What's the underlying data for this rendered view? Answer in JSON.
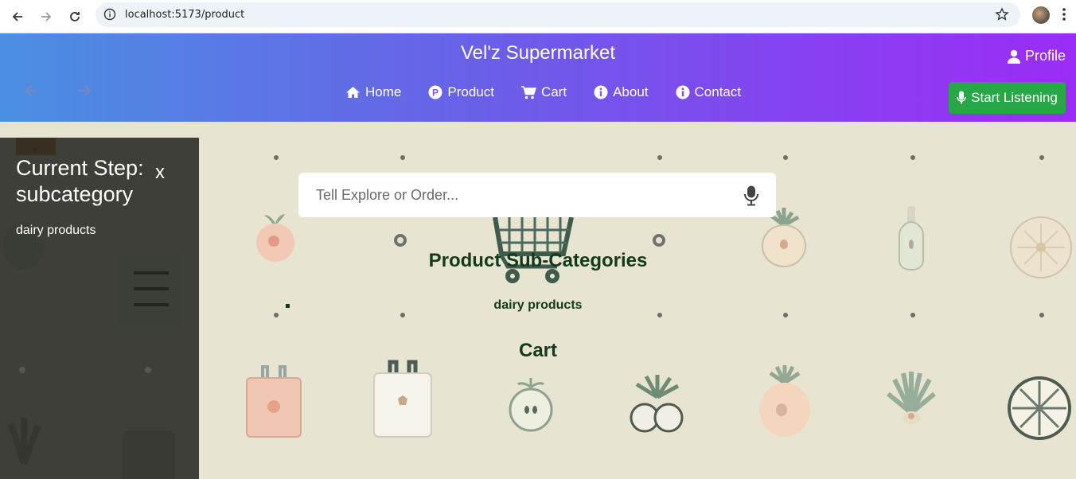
{
  "browser": {
    "url": "localhost:5173/product"
  },
  "header": {
    "title": "Vel'z Supermarket",
    "profile_label": "Profile",
    "nav": [
      {
        "label": "Home",
        "icon": "home-icon"
      },
      {
        "label": "Product",
        "icon": "product-p-icon"
      },
      {
        "label": "Cart",
        "icon": "cart-icon"
      },
      {
        "label": "About",
        "icon": "info-icon"
      },
      {
        "label": "Contact",
        "icon": "info-icon"
      }
    ],
    "listen_button": "Start Listening"
  },
  "side_panel": {
    "step_title": "Current Step: subcategory",
    "close_label": "x",
    "step_value": "dairy products",
    "tab_label": "x"
  },
  "search": {
    "placeholder": "Tell Explore or Order..."
  },
  "main": {
    "subcategories_heading": "Product Sub-Categories",
    "subcategory_item": "dairy products",
    "cart_heading": "Cart"
  },
  "colors": {
    "header_gradient_start": "#4a90e2",
    "header_gradient_end": "#9b2cf5",
    "listen_button": "#27a745",
    "heading_text": "#123a1d",
    "background": "#e8e4d2"
  }
}
